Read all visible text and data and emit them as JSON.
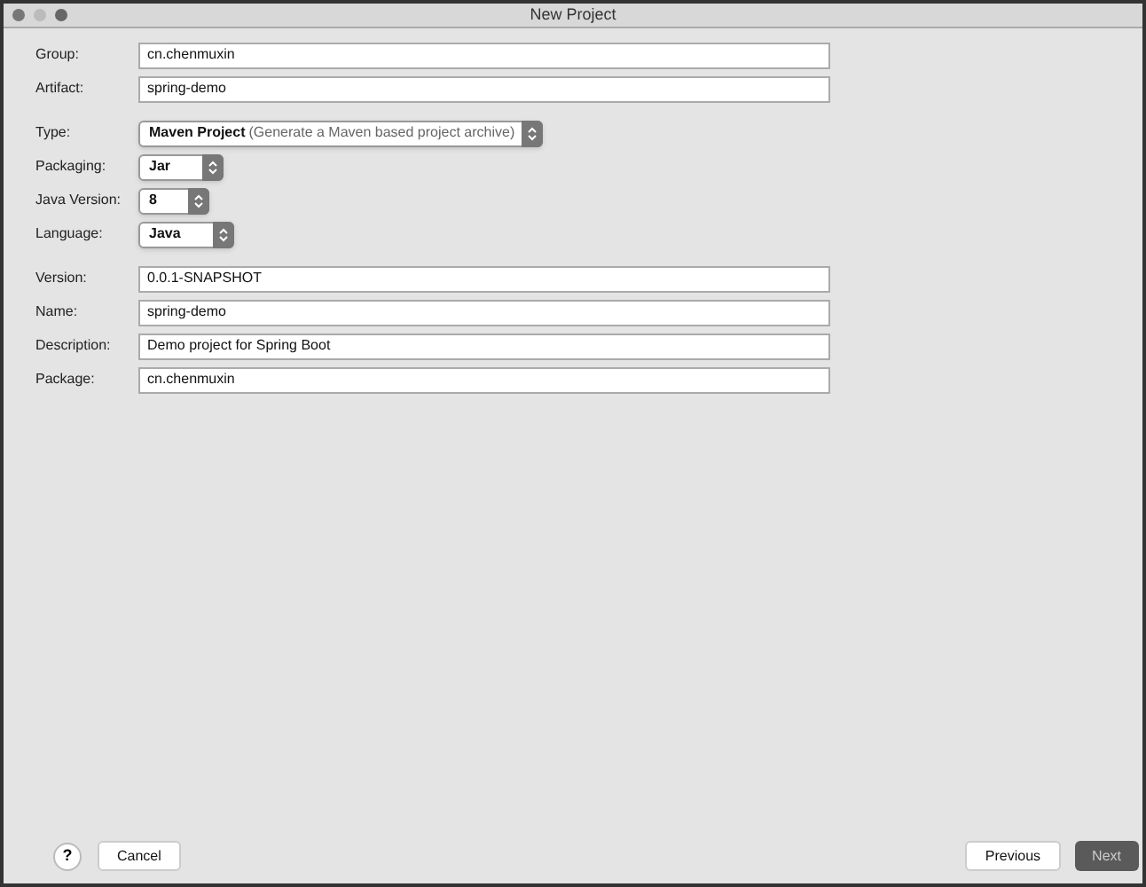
{
  "window": {
    "title": "New Project"
  },
  "sections": [
    {
      "fields": [
        {
          "label": "Group:",
          "kind": "text",
          "value": "cn.chenmuxin"
        },
        {
          "label": "Artifact:",
          "kind": "text",
          "value": "spring-demo"
        }
      ]
    },
    {
      "fields": [
        {
          "label": "Type:",
          "kind": "select",
          "value": "Maven Project",
          "hint": "(Generate a Maven based project archive)"
        },
        {
          "label": "Packaging:",
          "kind": "select",
          "value": "Jar"
        },
        {
          "label": "Java Version:",
          "kind": "select",
          "value": "8"
        },
        {
          "label": "Language:",
          "kind": "select",
          "value": "Java"
        }
      ]
    },
    {
      "fields": [
        {
          "label": "Version:",
          "kind": "text",
          "value": "0.0.1-SNAPSHOT"
        },
        {
          "label": "Name:",
          "kind": "text",
          "value": "spring-demo"
        },
        {
          "label": "Description:",
          "kind": "text",
          "value": "Demo project for Spring Boot"
        },
        {
          "label": "Package:",
          "kind": "text",
          "value": "cn.chenmuxin"
        }
      ]
    }
  ],
  "help_button": {
    "label": "?"
  },
  "buttons_left": [
    {
      "label": "Cancel",
      "kind": "default"
    }
  ],
  "buttons_right": [
    {
      "label": "Previous",
      "kind": "default"
    },
    {
      "label": "Next",
      "kind": "primary"
    }
  ]
}
